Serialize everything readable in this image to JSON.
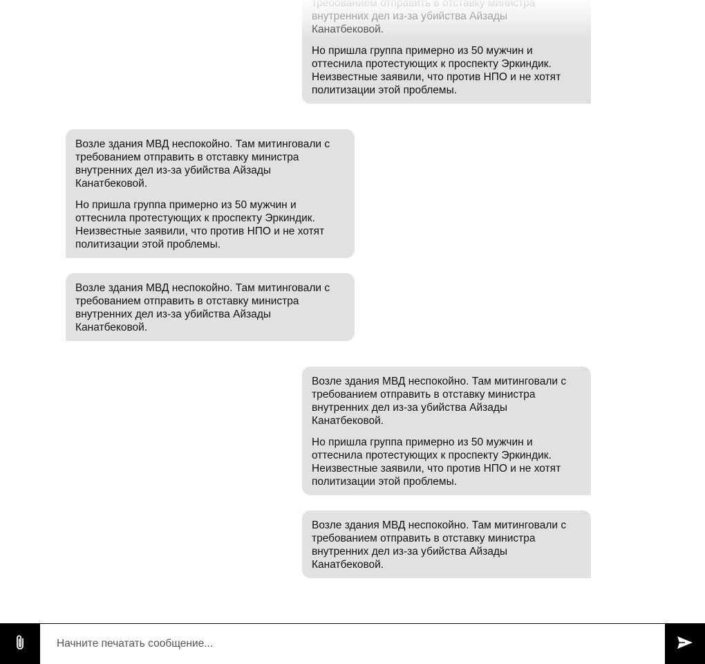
{
  "messages": [
    {
      "direction": "out",
      "paragraphs": [
        "Возле здания МВД неспокойно. Там митинговали с требованием отправить в отставку министра внутренних дел из-за убийства Айзады Канатбековой.",
        "Но пришла группа примерно из 50 мужчин и оттеснила протестующих к проспекту Эркиндик. Неизвестные заявили, что против НПО и не хотят политизации этой проблемы."
      ]
    },
    {
      "direction": "in",
      "paragraphs": [
        "Возле здания МВД неспокойно. Там митинговали с требованием отправить в отставку министра внутренних дел из-за убийства Айзады Канатбековой.",
        "Но пришла группа примерно из 50 мужчин и оттеснила протестующих к проспекту Эркиндик. Неизвестные заявили, что против НПО и не хотят политизации этой проблемы."
      ]
    },
    {
      "direction": "in",
      "paragraphs": [
        "Возле здания МВД неспокойно. Там митинговали с требованием отправить в отставку министра внутренних дел из-за убийства Айзады Канатбековой."
      ]
    },
    {
      "direction": "out",
      "paragraphs": [
        "Возле здания МВД неспокойно. Там митинговали с требованием отправить в отставку министра внутренних дел из-за убийства Айзады Канатбековой.",
        "Но пришла группа примерно из 50 мужчин и оттеснила протестующих к проспекту Эркиндик. Неизвестные заявили, что против НПО и не хотят политизации этой проблемы."
      ]
    },
    {
      "direction": "out",
      "paragraphs": [
        "Возле здания МВД неспокойно. Там митинговали с требованием отправить в отставку министра внутренних дел из-за убийства Айзады Канатбековой."
      ]
    }
  ],
  "composer": {
    "placeholder": "Начните печатать сообщение...",
    "value": "",
    "attach_icon": "paperclip-icon",
    "send_icon": "send-icon"
  },
  "colors": {
    "bubble": "#e1e1e1",
    "buttons": "#000000"
  }
}
